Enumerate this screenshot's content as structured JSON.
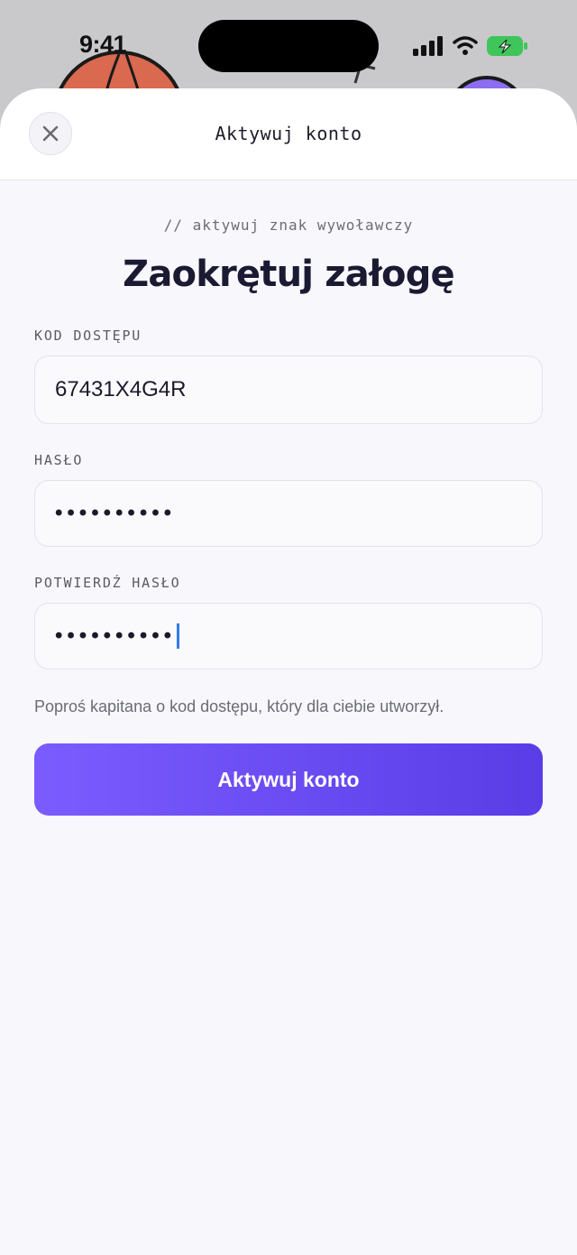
{
  "status_bar": {
    "time": "9:41"
  },
  "header": {
    "title": "Aktywuj konto",
    "close_icon": "close-icon"
  },
  "main": {
    "subtitle": "// aktywuj znak wywoławczy",
    "headline": "Zaokrętuj załogę",
    "fields": [
      {
        "label": "KOD DOSTĘPU",
        "value": "67431X4G4R"
      },
      {
        "label": "HASŁO",
        "value": "••••••••••"
      },
      {
        "label": "POTWIERDŹ HASŁO",
        "value": "••••••••••"
      }
    ],
    "hint": "Poproś kapitana o kod dostępu, który dla ciebie utworzył.",
    "submit_label": "Aktywuj konto"
  },
  "colors": {
    "accent_start": "#7a5cff",
    "accent_end": "#5a3de6",
    "battery": "#3fc55a"
  }
}
